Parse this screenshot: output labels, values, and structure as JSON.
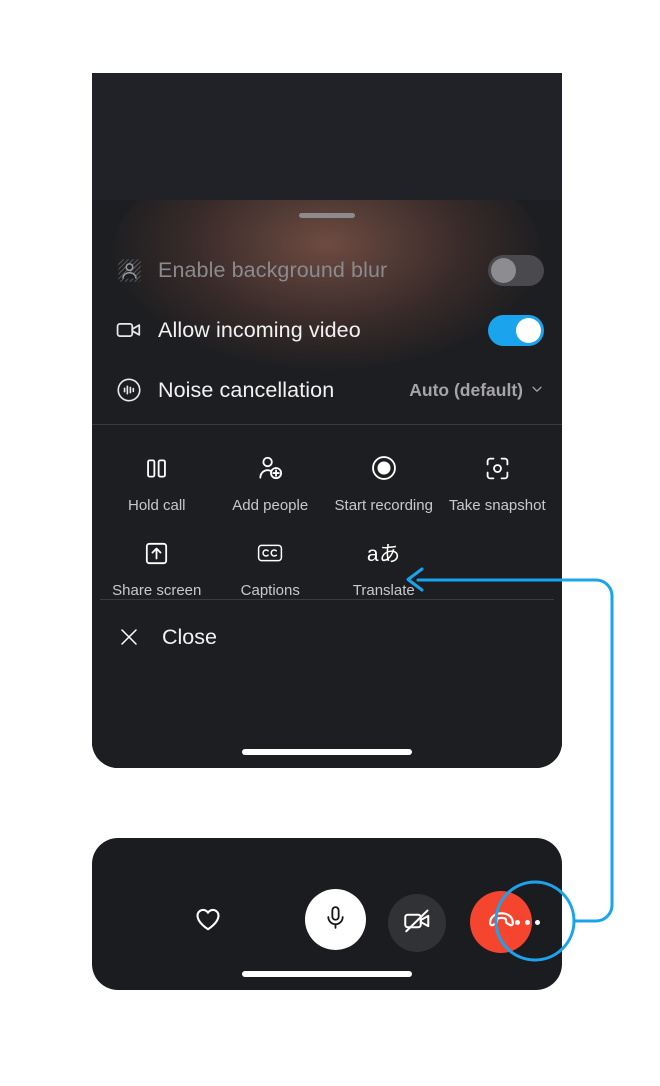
{
  "app": {
    "screen_name": "Skype call — more options sheet",
    "accent_color": "#1ba4ee",
    "sheet_background": "#1d1e21",
    "end_call_color": "#f5452f"
  },
  "sheet": {
    "drag_handle": "drag-handle",
    "settings": [
      {
        "id": "background-blur",
        "icon": "background-blur-icon",
        "label": "Enable background blur",
        "control": "toggle",
        "state": "off",
        "enabled": false
      },
      {
        "id": "incoming-video",
        "icon": "video-camera-icon",
        "label": "Allow incoming video",
        "control": "toggle",
        "state": "on",
        "enabled": true
      },
      {
        "id": "noise-cancellation",
        "icon": "noise-cancellation-icon",
        "label": "Noise cancellation",
        "control": "dropdown",
        "value": "Auto (default)",
        "chevron": "chevron-down-icon"
      }
    ],
    "actions": [
      {
        "id": "hold-call",
        "icon": "pause-icon",
        "label": "Hold call"
      },
      {
        "id": "add-people",
        "icon": "add-person-icon",
        "label": "Add people"
      },
      {
        "id": "start-recording",
        "icon": "record-icon",
        "label": "Start recording"
      },
      {
        "id": "take-snapshot",
        "icon": "snapshot-icon",
        "label": "Take snapshot"
      },
      {
        "id": "share-screen",
        "icon": "share-screen-icon",
        "label": "Share screen"
      },
      {
        "id": "captions",
        "icon": "captions-cc-icon",
        "label": "Captions"
      },
      {
        "id": "translate",
        "icon": "translate-icon",
        "label": "Translate",
        "icon_text": "aあ"
      }
    ],
    "close": {
      "icon": "close-x-icon",
      "label": "Close"
    }
  },
  "call_bar": {
    "controls": [
      {
        "id": "reactions",
        "icon": "heart-icon",
        "label": "Reactions"
      },
      {
        "id": "microphone",
        "icon": "microphone-icon",
        "label": "Microphone",
        "state": "on"
      },
      {
        "id": "camera",
        "icon": "camera-off-icon",
        "label": "Camera",
        "state": "off"
      },
      {
        "id": "end-call",
        "icon": "end-call-icon",
        "label": "End call"
      },
      {
        "id": "more",
        "icon": "more-dots-icon",
        "label": "More options",
        "highlighted": true
      }
    ]
  },
  "annotation": {
    "type": "callout-arrow",
    "color": "#1ba4ee",
    "from": "more-options-button",
    "to": "translate-action"
  }
}
